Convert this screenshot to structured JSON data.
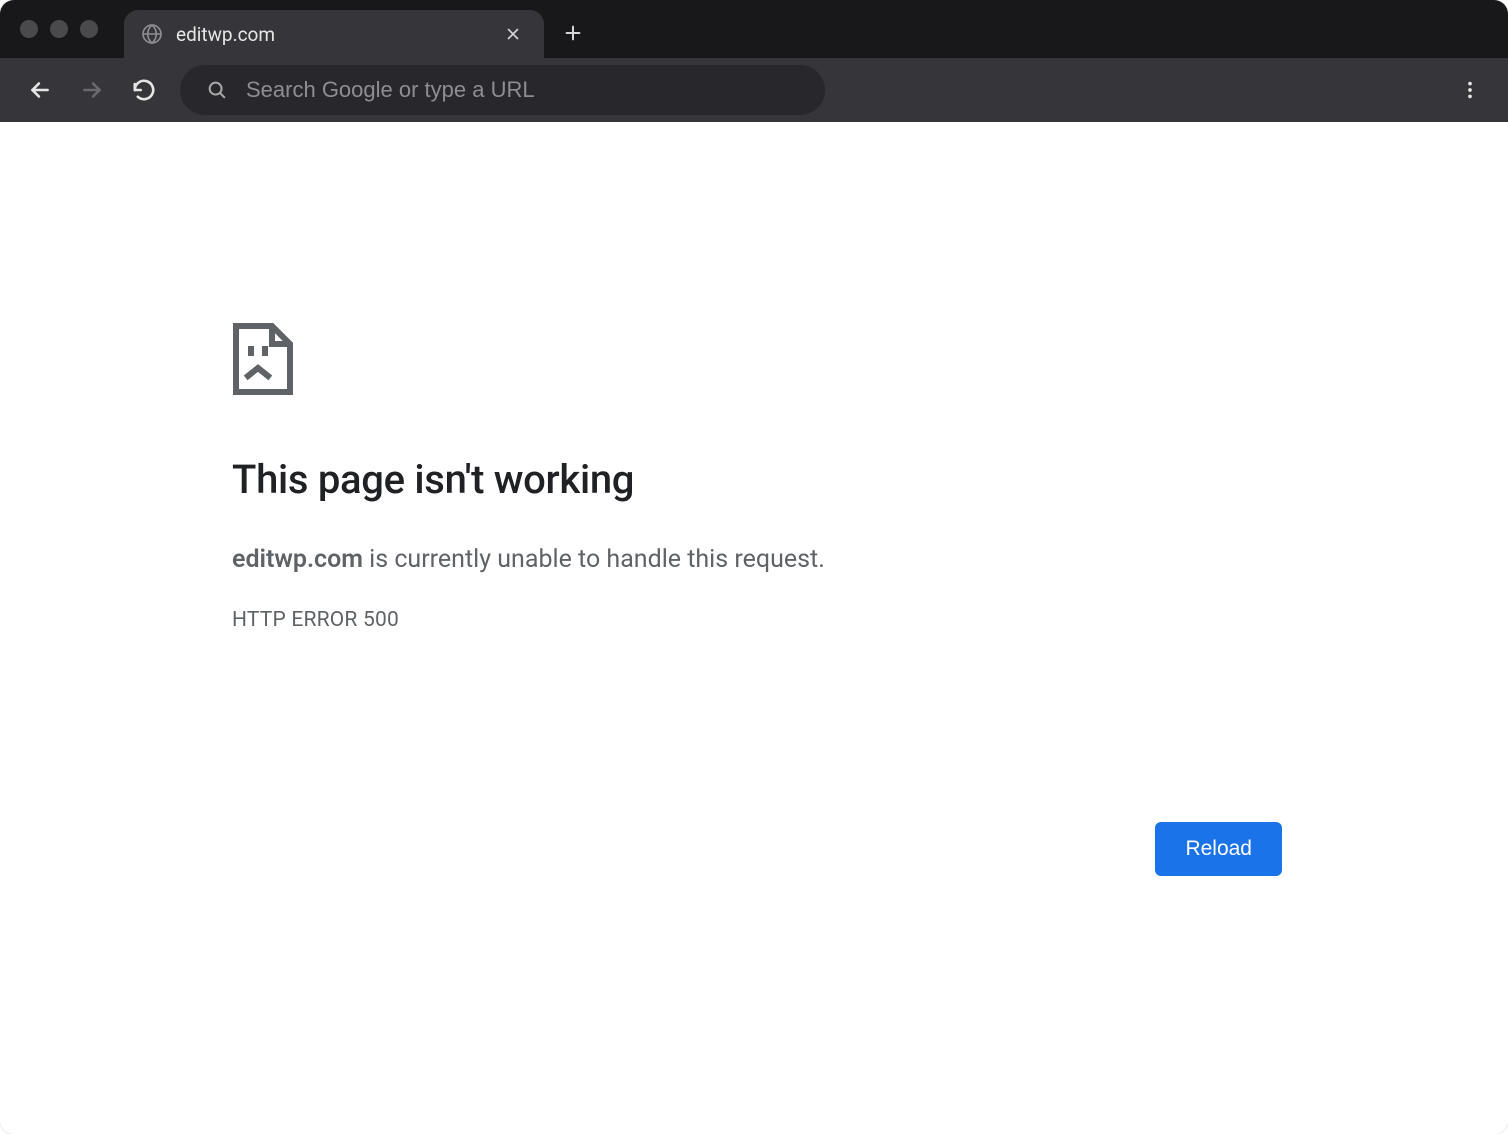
{
  "tab": {
    "title": "editwp.com"
  },
  "omnibox": {
    "placeholder": "Search Google or type a URL",
    "value": ""
  },
  "error": {
    "title": "This page isn't working",
    "host": "editwp.com",
    "subtitle_suffix": " is currently unable to handle this request.",
    "code": "HTTP ERROR 500",
    "reload_label": "Reload"
  }
}
